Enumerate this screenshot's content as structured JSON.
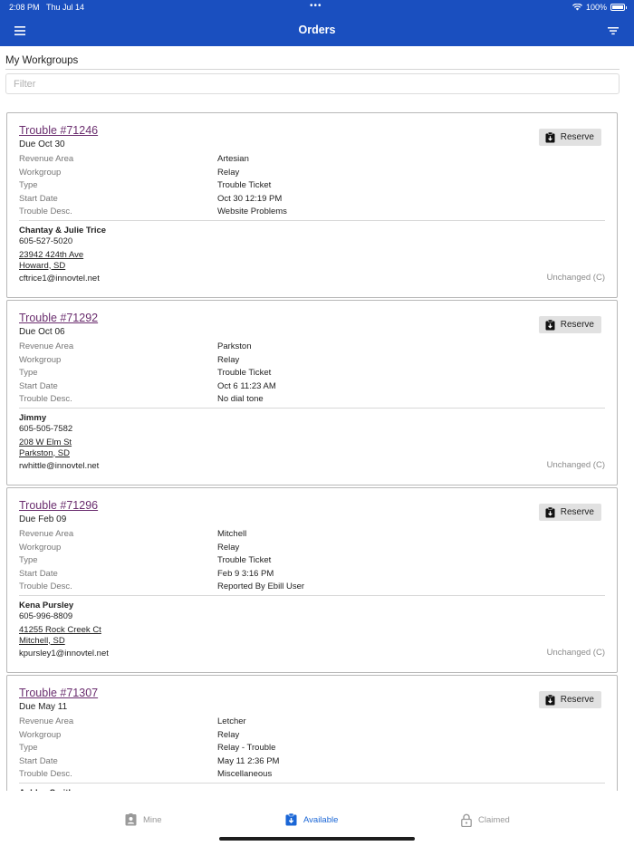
{
  "status_bar": {
    "time": "2:08 PM",
    "date": "Thu Jul 14",
    "battery": "100%",
    "battery_level": 1.0
  },
  "nav": {
    "title": "Orders"
  },
  "section": {
    "title": "My Workgroups"
  },
  "filter": {
    "placeholder": "Filter",
    "value": ""
  },
  "labels": {
    "revenue_area": "Revenue Area",
    "workgroup": "Workgroup",
    "type": "Type",
    "start_date": "Start Date",
    "trouble_desc": "Trouble Desc.",
    "reserve": "Reserve"
  },
  "orders": [
    {
      "title": "Trouble #71246",
      "due": "Due Oct 30",
      "revenue_area": "Artesian",
      "workgroup": "Relay",
      "type": "Trouble Ticket",
      "start_date": "Oct 30 12:19 PM",
      "trouble_desc": "Website Problems",
      "contact_name": "Chantay & Julie Trice",
      "phone": "605-527-5020",
      "address_line1": "23942 424th Ave",
      "address_line2": "Howard, SD",
      "email": "cftrice1@innovtel.net",
      "status": "Unchanged (C)"
    },
    {
      "title": "Trouble #71292",
      "due": "Due Oct 06",
      "revenue_area": "Parkston",
      "workgroup": "Relay",
      "type": "Trouble Ticket",
      "start_date": "Oct 6 11:23 AM",
      "trouble_desc": "No dial tone",
      "contact_name": "Jimmy",
      "phone": "605-505-7582",
      "address_line1": "208 W Elm St",
      "address_line2": "Parkston, SD",
      "email": "rwhittle@innovtel.net",
      "status": "Unchanged (C)"
    },
    {
      "title": "Trouble #71296",
      "due": "Due Feb 09",
      "revenue_area": "Mitchell",
      "workgroup": "Relay",
      "type": "Trouble Ticket",
      "start_date": "Feb 9 3:16 PM",
      "trouble_desc": "Reported By Ebill User",
      "contact_name": "Kena Pursley",
      "phone": "605-996-8809",
      "address_line1": "41255 Rock Creek Ct",
      "address_line2": "Mitchell, SD",
      "email": "kpursley1@innovtel.net",
      "status": "Unchanged (C)"
    },
    {
      "title": "Trouble #71307",
      "due": "Due May 11",
      "revenue_area": "Letcher",
      "workgroup": "Relay",
      "type": "Relay - Trouble",
      "start_date": "May 11 2:36 PM",
      "trouble_desc": "Miscellaneous",
      "contact_name": "Ashley Smith",
      "phone": "",
      "address_line1": "",
      "address_line2": "",
      "email": "",
      "status": ""
    }
  ],
  "tabs": [
    {
      "label": "Mine",
      "icon": "id-badge-icon",
      "active": false
    },
    {
      "label": "Available",
      "icon": "clipboard-download-icon",
      "active": true
    },
    {
      "label": "Claimed",
      "icon": "lock-icon",
      "active": false
    }
  ],
  "colors": {
    "header": "#1a4fbf",
    "active_tab": "#1a66d6",
    "link": "#6a2d6e"
  }
}
